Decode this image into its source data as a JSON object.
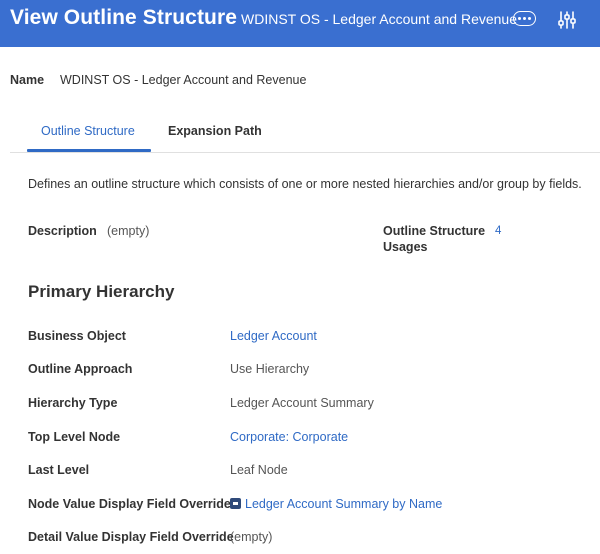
{
  "header": {
    "title": "View Outline Structure",
    "subtitle": "WDINST OS - Ledger Account and Revenue",
    "more_icon": "more-options-icon",
    "settings_icon": "related-actions-icon",
    "background_color": "#3a6fd0"
  },
  "name": {
    "label": "Name",
    "value": "WDINST OS - Ledger Account and Revenue"
  },
  "tabs": [
    {
      "label": "Outline Structure",
      "active": true
    },
    {
      "label": "Expansion Path",
      "active": false
    }
  ],
  "description_text": "Defines an outline structure which consists of one or more nested hierarchies and/or group by fields.",
  "summary": {
    "description_label": "Description",
    "description_value": "(empty)",
    "usages_label_line1": "Outline Structure",
    "usages_label_line2": "Usages",
    "usages_value": "4"
  },
  "primary_hierarchy": {
    "title": "Primary Hierarchy",
    "fields": [
      {
        "label": "Business Object",
        "value": "Ledger Account",
        "link": true
      },
      {
        "label": "Outline Approach",
        "value": "Use Hierarchy",
        "link": false
      },
      {
        "label": "Hierarchy Type",
        "value": "Ledger Account Summary",
        "link": false
      },
      {
        "label": "Top Level Node",
        "value": "Corporate: Corporate",
        "link": true
      },
      {
        "label": "Last Level",
        "value": "Leaf Node",
        "link": false
      },
      {
        "label": "Node Value Display Field Override",
        "value": "Ledger Account Summary by Name",
        "link": true,
        "icon": "report-field-icon"
      },
      {
        "label": "Detail Value Display Field Override",
        "value": "(empty)",
        "link": false
      }
    ]
  },
  "colors": {
    "accent": "#2f6ac5",
    "text": "#333333"
  }
}
